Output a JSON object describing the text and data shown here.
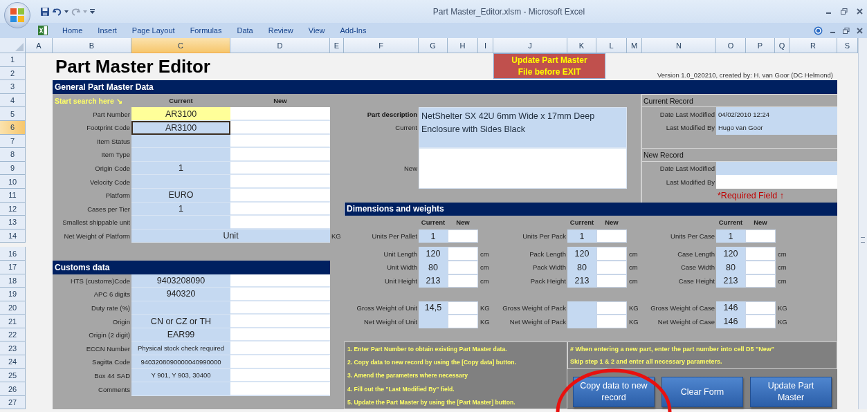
{
  "window": {
    "title": "Part Master_Editor.xlsm - Microsoft Excel"
  },
  "ribbon_tabs": [
    "Home",
    "Insert",
    "Page Layout",
    "Formulas",
    "Data",
    "Review",
    "View",
    "Add-Ins"
  ],
  "column_headers": [
    {
      "label": "A",
      "selected": false
    },
    {
      "label": "B",
      "selected": false
    },
    {
      "label": "C",
      "selected": true
    },
    {
      "label": "D",
      "selected": false
    },
    {
      "label": "E",
      "selected": false
    },
    {
      "label": "F",
      "selected": false
    },
    {
      "label": "G",
      "selected": false
    },
    {
      "label": "H",
      "selected": false
    },
    {
      "label": "I",
      "selected": false
    },
    {
      "label": "J",
      "selected": false
    },
    {
      "label": "K",
      "selected": false
    },
    {
      "label": "L",
      "selected": false
    },
    {
      "label": "M",
      "selected": false
    },
    {
      "label": "N",
      "selected": false
    },
    {
      "label": "O",
      "selected": false
    },
    {
      "label": "P",
      "selected": false
    },
    {
      "label": "Q",
      "selected": false
    },
    {
      "label": "R",
      "selected": false
    },
    {
      "label": "S",
      "selected": false
    }
  ],
  "row_headers": [
    {
      "label": "1",
      "selected": false
    },
    {
      "label": "2",
      "selected": false
    },
    {
      "label": "3",
      "selected": false
    },
    {
      "label": "4",
      "selected": false
    },
    {
      "label": "5",
      "selected": false
    },
    {
      "label": "6",
      "selected": true
    },
    {
      "label": "7",
      "selected": false
    },
    {
      "label": "8",
      "selected": false
    },
    {
      "label": "9",
      "selected": false
    },
    {
      "label": "10",
      "selected": false
    },
    {
      "label": "11",
      "selected": false
    },
    {
      "label": "12",
      "selected": false
    },
    {
      "label": "13",
      "selected": false
    },
    {
      "label": "14",
      "selected": false
    },
    {
      "label": "16",
      "selected": false
    },
    {
      "label": "17",
      "selected": false
    },
    {
      "label": "18",
      "selected": false
    },
    {
      "label": "19",
      "selected": false
    },
    {
      "label": "20",
      "selected": false
    },
    {
      "label": "21",
      "selected": false
    },
    {
      "label": "22",
      "selected": false
    },
    {
      "label": "23",
      "selected": false
    },
    {
      "label": "24",
      "selected": false
    },
    {
      "label": "25",
      "selected": false
    },
    {
      "label": "26",
      "selected": false
    },
    {
      "label": "27",
      "selected": false
    }
  ],
  "sheet": {
    "title": "Part Master Editor",
    "warning_lines": [
      "Update Part Master",
      "File before EXIT"
    ],
    "version": "Version 1.0_020210, created by: H. van Goor (DC Helmond)",
    "general": {
      "title": "General Part Master Data",
      "search_hint": "Start search here ↘",
      "current_header": "Current",
      "new_header": "New",
      "fields": [
        {
          "label": "Part Number",
          "current": "AR3100",
          "kind": "input",
          "highlighted": true,
          "selected": false
        },
        {
          "label": "Footprint Code",
          "current": "AR3100",
          "kind": "input",
          "highlighted": false,
          "selected": true
        },
        {
          "label": "Item Status",
          "kind": "input",
          "highlighted": false,
          "selected": false
        },
        {
          "label": "Item Type",
          "kind": "input",
          "highlighted": false,
          "selected": false
        },
        {
          "label": "Origin Code",
          "current": "1",
          "kind": "input",
          "highlighted": false,
          "selected": false
        },
        {
          "label": "Velocity Code",
          "kind": "input",
          "highlighted": false,
          "selected": false
        },
        {
          "label": "Platform",
          "current": "EURO",
          "kind": "input",
          "highlighted": false,
          "selected": false
        },
        {
          "label": "Cases per Tier",
          "current": "1",
          "kind": "input",
          "highlighted": false,
          "selected": false
        },
        {
          "label": "Smallest shippable unit",
          "kind": "input",
          "highlighted": false,
          "selected": false
        },
        {
          "label": "Net Weight of Platform",
          "current": "Unit",
          "kind": "display",
          "unit": "KG",
          "highlighted": false,
          "selected": false
        }
      ]
    },
    "customs": {
      "title": "Customs data",
      "fields": [
        {
          "label": "HTS (customs)Code",
          "current": "9403208090",
          "small_text": false
        },
        {
          "label": "APC 6 digits",
          "current": "940320",
          "small_text": false
        },
        {
          "label": "Duty rate (%)"
        },
        {
          "label": "Origin",
          "current": "CN or CZ or TH",
          "small_text": false
        },
        {
          "label": "Origin (2 digit)",
          "current": "EAR99",
          "small_text": false
        },
        {
          "label": "ECCN Number",
          "current": "Physical stock check required",
          "small_text": true
        },
        {
          "label": "Sagitta Code",
          "current": "9403208090000040990000",
          "small_text": true
        },
        {
          "label": "Box 44 SAD",
          "current": "Y 901, Y 903, 30400",
          "small_text": true
        },
        {
          "label": "Comments"
        }
      ]
    },
    "description": {
      "label": "Part description",
      "current_label": "Current",
      "current": "NetShelter SX 42U 6mm Wide x 17mm Deep Enclosure with Sides Black",
      "new_label": "New"
    },
    "records": [
      {
        "title": "Current Record",
        "rows": [
          {
            "label": "Date Last Modified",
            "value": "04/02/2010 12:24",
            "kind": "display"
          },
          {
            "label": "Last Modified By",
            "value": "Hugo van Goor",
            "kind": "display"
          }
        ]
      },
      {
        "title": "New Record",
        "rows": [
          {
            "label": "Date Last Modified",
            "kind": "display"
          },
          {
            "label": "Last Modified By",
            "kind": "input"
          }
        ],
        "required_note": "*Required Field ↑"
      }
    ],
    "dimensions": {
      "title": "Dimensions and weights",
      "groups": [
        {
          "current_header": "Current",
          "new_header": "New",
          "blocks": [
            [
              {
                "label": "Units Per Pallet",
                "current": "1"
              }
            ],
            [
              {
                "label": "Unit Length",
                "current": "120",
                "unit": "cm"
              },
              {
                "label": "Unit Width",
                "current": "80",
                "unit": "cm"
              },
              {
                "label": "Unit Height",
                "current": "213",
                "unit": "cm"
              }
            ],
            [
              {
                "label": "Gross Weight of Unit",
                "current": "14,5",
                "unit": "KG"
              },
              {
                "label": "Net Weight of Unit",
                "unit": "KG"
              }
            ]
          ]
        },
        {
          "current_header": "Current",
          "new_header": "New",
          "blocks": [
            [
              {
                "label": "Units Per Pack",
                "current": "1"
              }
            ],
            [
              {
                "label": "Pack Length",
                "current": "120",
                "unit": "cm"
              },
              {
                "label": "Pack Width",
                "current": "80",
                "unit": "cm"
              },
              {
                "label": "Pack Height",
                "current": "213",
                "unit": "cm"
              }
            ],
            [
              {
                "label": "Gross Weight of Pack",
                "unit": "KG"
              },
              {
                "label": "Net Weight of Pack",
                "unit": "KG"
              }
            ]
          ]
        },
        {
          "current_header": "Current",
          "new_header": "New",
          "blocks": [
            [
              {
                "label": "Units Per Case",
                "current": "1"
              }
            ],
            [
              {
                "label": "Case Length",
                "current": "120",
                "unit": "cm"
              },
              {
                "label": "Case Width",
                "current": "80",
                "unit": "cm"
              },
              {
                "label": "Case Height",
                "current": "213",
                "unit": "cm"
              }
            ],
            [
              {
                "label": "Gross Weight of Case",
                "current": "146",
                "unit": "KG"
              },
              {
                "label": "Net Weight of Case",
                "current": "146",
                "unit": "KG"
              }
            ]
          ]
        }
      ]
    },
    "instructions": [
      "1. Enter Part Number to obtain existing Part Master data.",
      "2. Copy data to new record by using the [Copy data] button.",
      "3. Amend the parameters where necessary",
      "4. Fill out the \"Last Modified By\" field.",
      "5. Update the Part Master by using the [Part Master] button."
    ],
    "note": [
      "# When entering a new part, enter the part number into cell D5 \"New\"",
      "Skip step 1 & 2 and enter all necessary parameters."
    ],
    "buttons": [
      "Copy data to new record",
      "Clear Form",
      "Update Part Master"
    ]
  }
}
